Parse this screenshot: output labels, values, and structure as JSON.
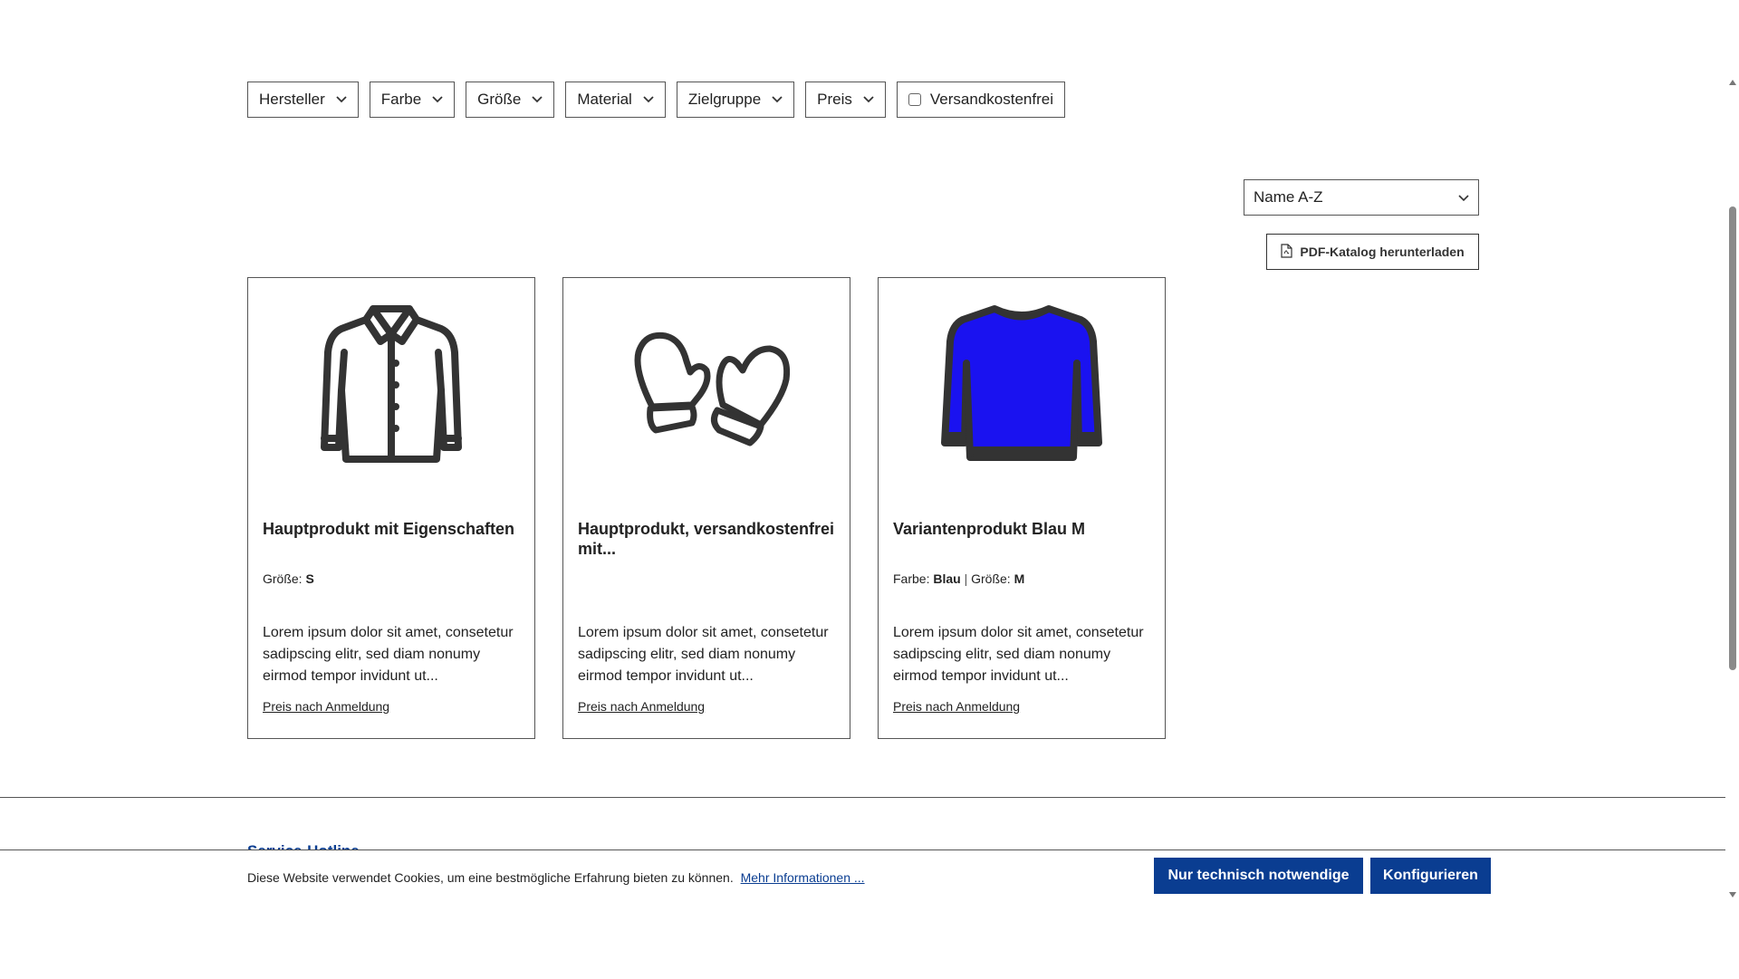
{
  "filters": {
    "items": [
      {
        "label": "Hersteller"
      },
      {
        "label": "Farbe"
      },
      {
        "label": "Größe"
      },
      {
        "label": "Material"
      },
      {
        "label": "Zielgruppe"
      },
      {
        "label": "Preis"
      }
    ],
    "free_shipping_label": "Versandkostenfrei"
  },
  "sort": {
    "selected": "Name A-Z"
  },
  "pdf_button": {
    "label": "PDF-Katalog herunterladen"
  },
  "products": [
    {
      "title": "Hauptprodukt mit Eigenschaften",
      "props": [
        {
          "name": "Größe:",
          "value": "S"
        }
      ],
      "description": "Lorem ipsum dolor sit amet, consetetur sadipscing elitr, sed diam nonumy eirmod tempor invidunt ut...",
      "price": "Preis nach Anmeldung",
      "icon": "jacket-icon"
    },
    {
      "title": "Hauptprodukt, versandkostenfrei mit...",
      "props": [],
      "description": "Lorem ipsum dolor sit amet, consetetur sadipscing elitr, sed diam nonumy eirmod tempor invidunt ut...",
      "price": "Preis nach Anmeldung",
      "icon": "mittens-icon"
    },
    {
      "title": "Variantenprodukt Blau M",
      "props": [
        {
          "name": "Farbe:",
          "value": "Blau"
        },
        {
          "name": "Größe:",
          "value": "M"
        }
      ],
      "description": "Lorem ipsum dolor sit amet, consetetur sadipscing elitr, sed diam nonumy eirmod tempor invidunt ut...",
      "price": "Preis nach Anmeldung",
      "icon": "sweater-icon"
    }
  ],
  "footer": {
    "heading": "Service-Hotline"
  },
  "cookie": {
    "text": "Diese Website verwendet Cookies, um eine bestmögliche Erfahrung bieten zu können.",
    "link": "Mehr Informationen ...",
    "btn_technical": "Nur technisch notwendige",
    "btn_configure": "Konfigurieren"
  },
  "colors": {
    "accent": "#0a3d91",
    "sweater": "#1a12f0"
  }
}
